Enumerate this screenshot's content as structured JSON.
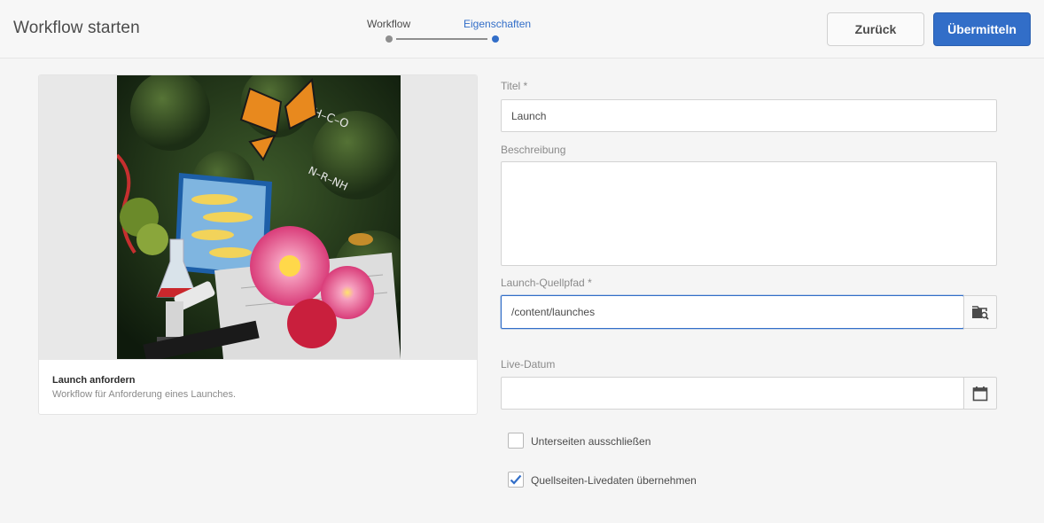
{
  "header": {
    "title": "Workflow starten",
    "steps": [
      {
        "label": "Workflow",
        "state": "complete"
      },
      {
        "label": "Eigenschaften",
        "state": "current"
      }
    ],
    "back_label": "Zurück",
    "submit_label": "Übermitteln"
  },
  "card": {
    "title": "Launch anfordern",
    "description": "Workflow für Anforderung eines Launches."
  },
  "form": {
    "title_label": "Titel *",
    "title_value": "Launch",
    "description_label": "Beschreibung",
    "description_value": "",
    "source_path_label": "Launch-Quellpfad *",
    "source_path_value": "/content/launches",
    "live_date_label": "Live-Datum",
    "live_date_value": "",
    "exclude_subpages_label": "Unterseiten ausschließen",
    "exclude_subpages_checked": false,
    "inherit_livedata_label": "Quellseiten-Livedaten übernehmen",
    "inherit_livedata_checked": true
  },
  "icons": {
    "path_browser": "folder-search-icon",
    "date_picker": "calendar-icon",
    "checkmark": "checkmark-icon"
  },
  "colors": {
    "accent": "#326ec8",
    "background": "#f5f5f5"
  }
}
